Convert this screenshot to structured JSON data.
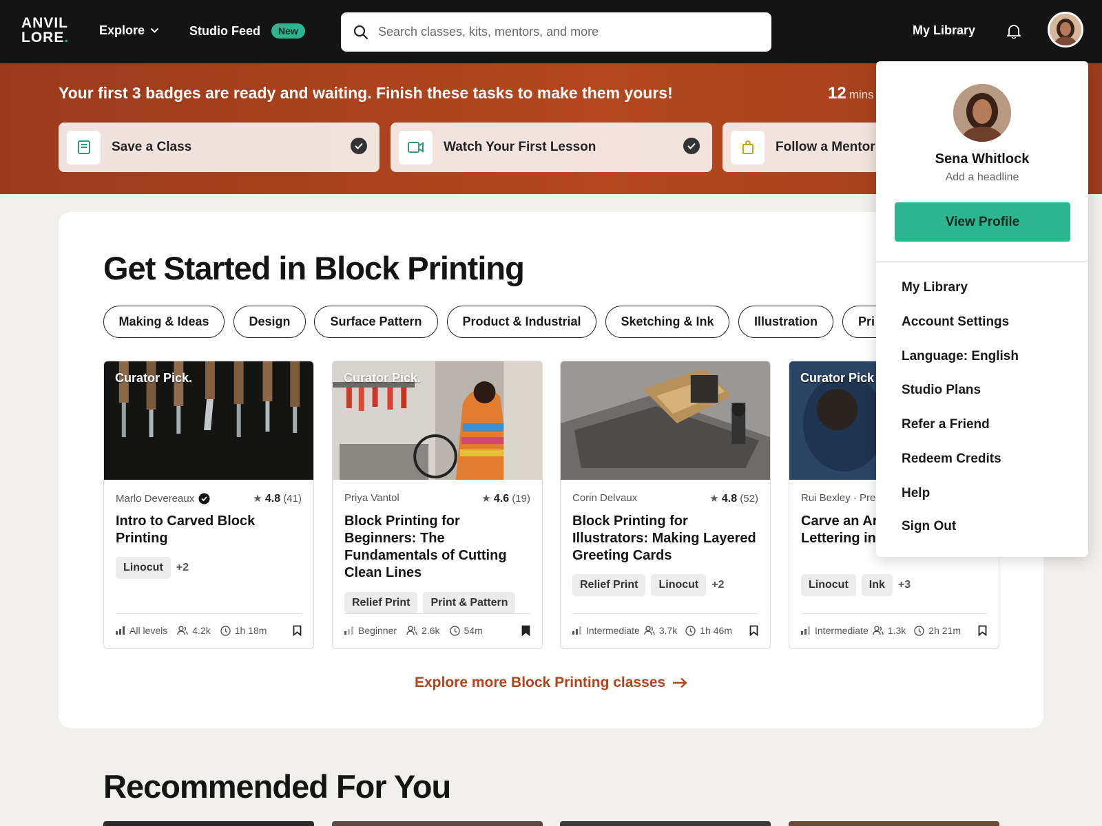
{
  "nav": {
    "logo_line1": "ANVIL",
    "logo_line2": "LORE",
    "logo_dot": ".",
    "explore": "Explore",
    "studio_feed": "Studio Feed",
    "new_badge": "New",
    "search_placeholder": "Search classes, kits, mentors, and more",
    "my_library": "My Library"
  },
  "banner": {
    "title": "Your first 3 badges are ready and waiting. Finish these tasks to make them yours!",
    "timer_value": "12",
    "timer_unit": "mins",
    "tasks": [
      {
        "label": "Save a Class",
        "icon": "bookmark-page-icon",
        "done": true
      },
      {
        "label": "Watch Your First Lesson",
        "icon": "video-camera-icon",
        "done": true
      },
      {
        "label": "Follow a Mentor",
        "icon": "shopping-bag-icon",
        "done": false
      }
    ]
  },
  "section": {
    "title": "Get Started in Block Printing",
    "chips": [
      "Making & Ideas",
      "Design",
      "Surface Pattern",
      "Product & Industrial",
      "Sketching & Ink",
      "Illustration",
      "Pri"
    ],
    "cards": [
      {
        "pick": "Curator Pick.",
        "author": "Marlo Devereaux",
        "verified": true,
        "rating": "4.8",
        "reviews": "(41)",
        "title": "Intro to Carved Block Printing",
        "tags": [
          "Linocut"
        ],
        "more": "+2",
        "level": "All levels",
        "students": "4.2k",
        "duration": "1h 18m",
        "saved": false
      },
      {
        "pick": "Curator Pick.",
        "author": "Priya Vantol",
        "verified": false,
        "rating": "4.6",
        "reviews": "(19)",
        "title": "Block Printing for Beginners: The Fundamentals of Cutting Clean Lines",
        "tags": [
          "Relief Print",
          "Print & Pattern"
        ],
        "more": "",
        "level": "Beginner",
        "students": "2.6k",
        "duration": "54m",
        "saved": true
      },
      {
        "pick": "",
        "author": "Corin Delvaux",
        "verified": false,
        "rating": "4.8",
        "reviews": "(52)",
        "title": "Block Printing for Illustrators: Making Layered Greeting Cards",
        "tags": [
          "Relief Print",
          "Linocut"
        ],
        "more": "+2",
        "level": "Intermediate",
        "students": "3.7k",
        "duration": "1h 46m",
        "saved": false
      },
      {
        "pick": "Curator Pick",
        "author": "Rui Bexley · Pre",
        "verified": false,
        "rating": "",
        "reviews": "",
        "title": "Carve an Ar Poster: Orn Lettering in Lino",
        "tags": [
          "Linocut",
          "Ink"
        ],
        "more": "+3",
        "level": "Intermediate",
        "students": "1.3k",
        "duration": "2h 21m",
        "saved": false
      }
    ],
    "explore_link": "Explore more Block Printing classes"
  },
  "recommended": {
    "title": "Recommended For You"
  },
  "profile_menu": {
    "name": "Sena Whitlock",
    "headline": "Add a headline",
    "view_profile": "View Profile",
    "items": [
      "My Library",
      "Account Settings",
      "Language: English",
      "Studio Plans",
      "Refer a Friend",
      "Redeem Credits",
      "Help",
      "Sign Out"
    ]
  },
  "colors": {
    "nav_bg": "#141414",
    "accent_green": "#2db58f",
    "banner_orange": "#b3481f",
    "link_orange": "#b0441c"
  }
}
